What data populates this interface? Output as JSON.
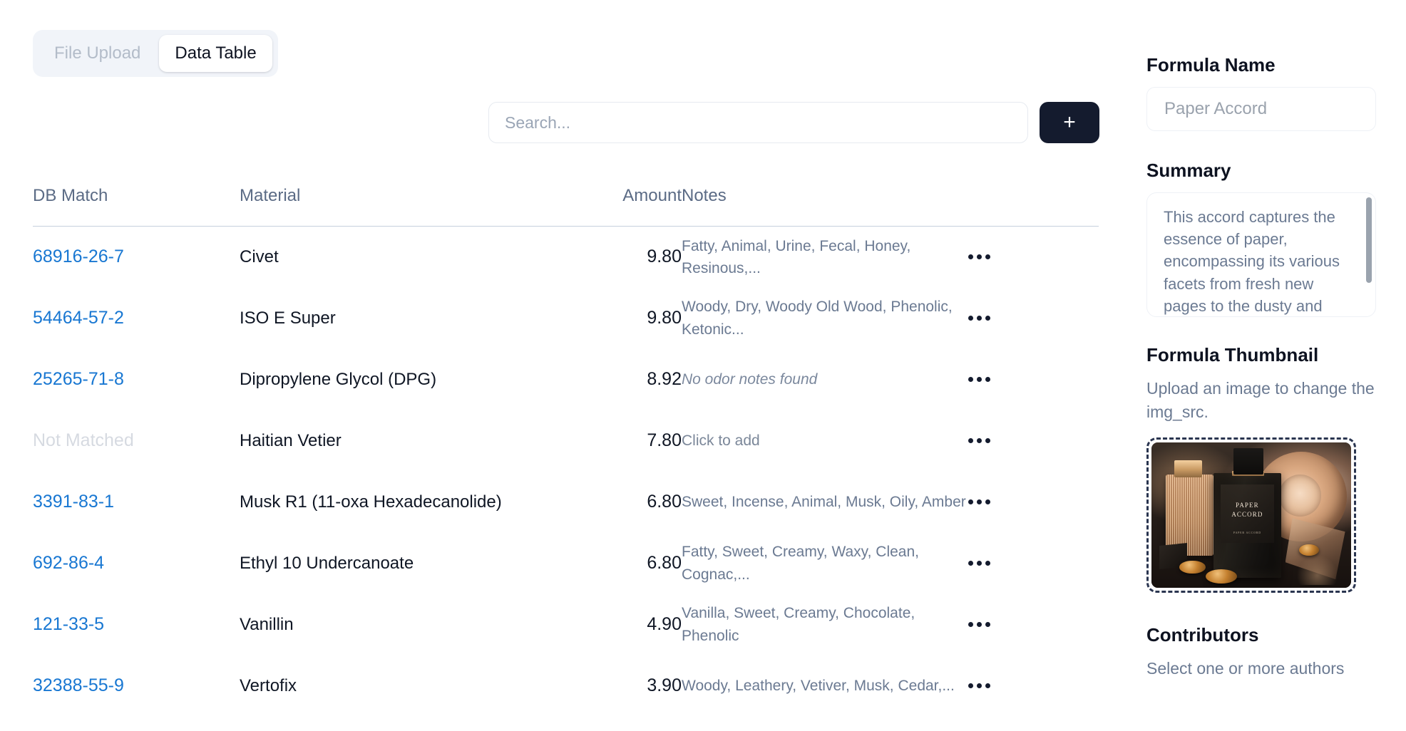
{
  "tabs": [
    {
      "label": "File Upload",
      "active": false
    },
    {
      "label": "Data Table",
      "active": true
    }
  ],
  "toolbar": {
    "search_value": "",
    "search_placeholder": "Search...",
    "add_label": "+"
  },
  "table": {
    "columns": [
      "DB Match",
      "Material",
      "Amount",
      "Notes",
      ""
    ],
    "rows": [
      {
        "db_match": "68916-26-7",
        "matched": true,
        "material": "Civet",
        "amount": "9.80",
        "notes": "Fatty, Animal, Urine, Fecal, Honey, Resinous,...",
        "notes_state": "filled",
        "menu": "•••"
      },
      {
        "db_match": "54464-57-2",
        "matched": true,
        "material": "ISO E Super",
        "amount": "9.80",
        "notes": "Woody, Dry, Woody Old Wood, Phenolic, Ketonic...",
        "notes_state": "filled",
        "menu": "•••"
      },
      {
        "db_match": "25265-71-8",
        "matched": true,
        "material": "Dipropylene Glycol (DPG)",
        "amount": "8.92",
        "notes": "No odor notes found",
        "notes_state": "empty",
        "menu": "•••"
      },
      {
        "db_match": "Not Matched",
        "matched": false,
        "material": "Haitian Vetier",
        "amount": "7.80",
        "notes": "Click to add",
        "notes_state": "add",
        "menu": "•••"
      },
      {
        "db_match": "3391-83-1",
        "matched": true,
        "material": "Musk R1 (11-oxa Hexadecanolide)",
        "amount": "6.80",
        "notes": "Sweet, Incense, Animal, Musk, Oily, Amber",
        "notes_state": "filled",
        "menu": "•••"
      },
      {
        "db_match": "692-86-4",
        "matched": true,
        "material": "Ethyl 10 Undercanoate",
        "amount": "6.80",
        "notes": "Fatty, Sweet, Creamy, Waxy, Clean, Cognac,...",
        "notes_state": "filled",
        "menu": "•••"
      },
      {
        "db_match": "121-33-5",
        "matched": true,
        "material": "Vanillin",
        "amount": "4.90",
        "notes": "Vanilla, Sweet, Creamy, Chocolate, Phenolic",
        "notes_state": "filled",
        "menu": "•••"
      },
      {
        "db_match": "32388-55-9",
        "matched": true,
        "material": "Vertofix",
        "amount": "3.90",
        "notes": "Woody, Leathery, Vetiver, Musk, Cedar,...",
        "notes_state": "filled",
        "menu": "•••"
      }
    ]
  },
  "panel": {
    "formula_name_label": "Formula Name",
    "formula_name_value": "",
    "formula_name_placeholder": "Paper Accord",
    "summary_label": "Summary",
    "summary_text": "This accord captures the essence of paper, encompassing its various facets from fresh new pages to the dusty and cool scent of old books.",
    "thumbnail_label": "Formula Thumbnail",
    "thumbnail_help": "Upload an image to change the img_src.",
    "thumbnail_brand_line1": "PAPER",
    "thumbnail_brand_line2": "ACCORD",
    "thumbnail_brand_sub": "PAPER ACCORD",
    "contributors_label": "Contributors",
    "contributors_help": "Select one or more authors"
  },
  "colors": {
    "link": "#1877d2",
    "unmatched": "#d6dae1",
    "dark": "#141b2e",
    "muted": "#6b7a92",
    "tab_inactive": "#b3bcc9",
    "tabbar_bg": "#f1f4f9",
    "border": "#c6cfdd"
  }
}
